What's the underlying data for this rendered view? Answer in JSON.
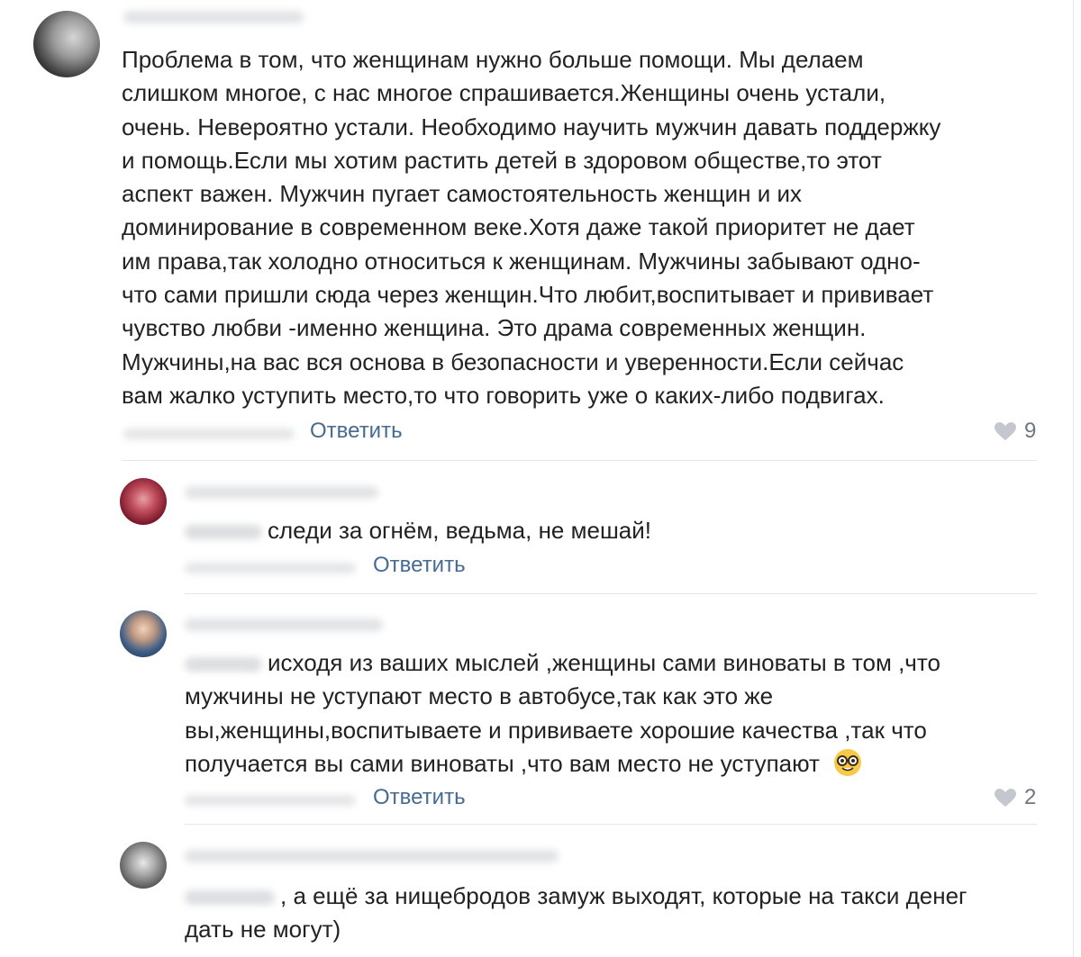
{
  "comments": [
    {
      "lines": [
        "Проблема в том, что женщинам нужно больше помощи. Мы делаем",
        "слишком многое, с нас многое спрашивается.Женщины очень устали,",
        "очень. Невероятно устали. Необходимо научить мужчин давать поддержку",
        "и помощь.Если мы хотим растить детей в здоровом обществе,то этот",
        "аспект важен. Мужчин пугает самостоятельность женщин и их",
        "доминирование в современном веке.Хотя даже такой приоритет не дает",
        "им права,так холодно относиться к женщинам. Мужчины забывают одно-",
        "что сами пришли сюда через женщин.Что любит,воспитывает и прививает",
        "чувство любви -именно женщина. Это драма современных женщин.",
        "Мужчины,на вас вся основа в безопасности и уверенности.Если сейчас",
        "вам жалко уступить место,то что говорить уже о каких-либо подвигах."
      ],
      "reply_label": "Ответить",
      "likes": "9"
    },
    {
      "lines": [
        "следи за огнём, ведьма, не мешай!"
      ],
      "reply_label": "Ответить"
    },
    {
      "lines": [
        "исходя из ваших мыслей ,женщины сами виноваты в том ,что",
        "мужчины не уступают место в автобусе,так как это же",
        "вы,женщины,воспитываете и прививаете хорошие качества ,так что",
        "получается вы сами виноваты ,что вам место не уступают"
      ],
      "emoji": "nerd-face-emoji",
      "reply_label": "Ответить",
      "likes": "2"
    },
    {
      "lines": [
        ", а ещё за нищебродов замуж выходят, которые на такси денег",
        "дать не могут)"
      ]
    }
  ],
  "colors": {
    "link": "#476a92",
    "text": "#222222",
    "like_gray": "#6e7681",
    "separator": "#e3e6ea"
  },
  "icons": {
    "like": "heart-icon"
  }
}
